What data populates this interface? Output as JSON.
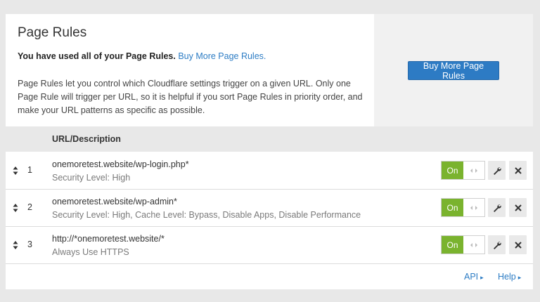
{
  "header": {
    "title": "Page Rules",
    "used_text": "You have used all of your Page Rules",
    "used_suffix": ".",
    "buy_link": "Buy More Page Rules.",
    "description": "Page Rules let you control which Cloudflare settings trigger on a given URL. Only one Page Rule will trigger per URL, so it is helpful if you sort Page Rules in priority order, and make your URL patterns as specific as possible.",
    "buy_button": "Buy More Page Rules"
  },
  "table": {
    "column_header": "URL/Description",
    "rows": [
      {
        "priority": "1",
        "url": "onemoretest.website/wp-login.php*",
        "description": "Security Level: High",
        "toggle": "On"
      },
      {
        "priority": "2",
        "url": "onemoretest.website/wp-admin*",
        "description": "Security Level: High, Cache Level: Bypass, Disable Apps, Disable Performance",
        "toggle": "On"
      },
      {
        "priority": "3",
        "url": "http://*onemoretest.website/*",
        "description": "Always Use HTTPS",
        "toggle": "On"
      }
    ]
  },
  "footer": {
    "api_label": "API",
    "help_label": "Help",
    "arrow": "▸"
  },
  "colors": {
    "accent": "#2d7bc4",
    "on_green": "#7ab32e",
    "link": "#2c7cc4"
  }
}
